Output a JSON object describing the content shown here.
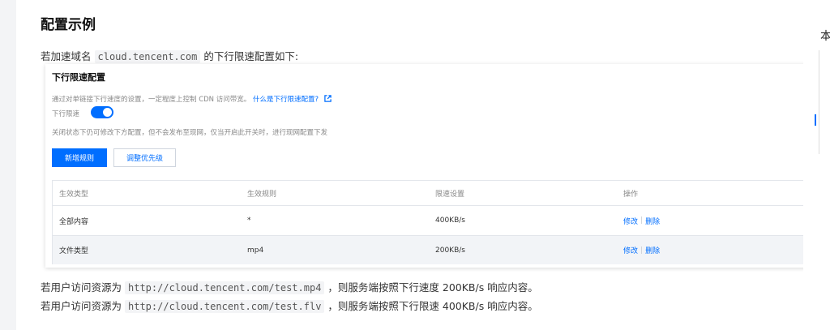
{
  "doc": {
    "heading": "配置示例",
    "intro_prefix": "若加速域名",
    "intro_domain": "cloud.tencent.com",
    "intro_suffix": "的下行限速配置如下:",
    "outro1_prefix": "若用户访问资源为",
    "outro1_url": "http://cloud.tencent.com/test.mp4",
    "outro1_suffix": "，则服务端按照下行速度 200KB/s 响应内容。",
    "outro2_prefix": "若用户访问资源为",
    "outro2_url": "http://cloud.tencent.com/test.flv",
    "outro2_suffix": "，则服务端按照下行限速 400KB/s 响应内容。"
  },
  "panel": {
    "title": "下行限速配置",
    "description": "通过对单链接下行速度的设置，一定程度上控制 CDN 访问带宽。",
    "help_link": "什么是下行限速配置?",
    "toggle_label": "下行限速",
    "toggle_on": true,
    "note": "关闭状态下仍可修改下方配置，但不会发布至现网，仅当开启此开关时，进行现网配置下发",
    "add_button": "新增规则",
    "priority_button": "调整优先级",
    "table": {
      "headers": [
        "生效类型",
        "生效规则",
        "限速设置",
        "操作"
      ],
      "rows": [
        {
          "type": "全部内容",
          "rule": "*",
          "limit": "400KB/s",
          "edit": "修改",
          "delete": "删除"
        },
        {
          "type": "文件类型",
          "rule": "mp4",
          "limit": "200KB/s",
          "edit": "修改",
          "delete": "删除"
        }
      ]
    }
  },
  "side": {
    "char": "本"
  },
  "colors": {
    "accent": "#006eff",
    "row_alt": "#f2f4f7"
  },
  "icons": {
    "help": "external-link-icon"
  }
}
